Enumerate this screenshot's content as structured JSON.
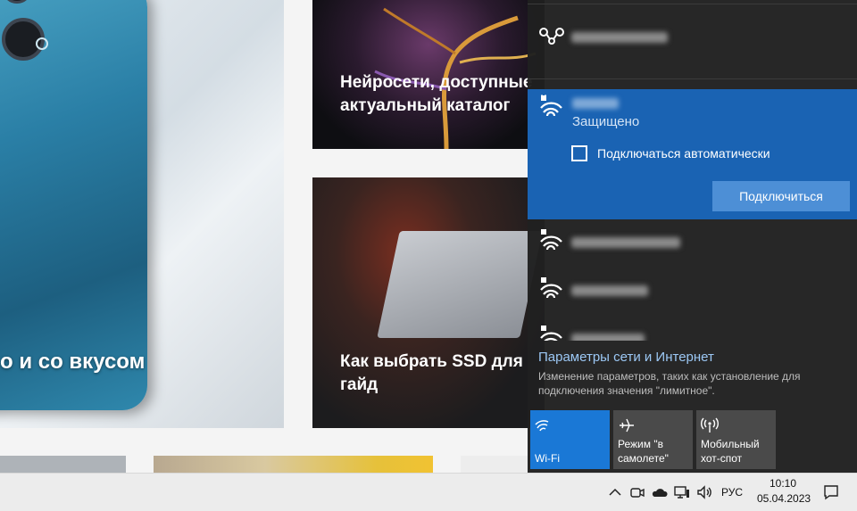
{
  "background": {
    "phone_caption": "о и со вкусом",
    "card_ai_caption": [
      "Нейросети, доступные",
      "актуальный каталог"
    ],
    "card_ssd_caption": [
      "Как выбрать SSD для",
      "гайд"
    ]
  },
  "flyout": {
    "active_network": {
      "status": "Защищено",
      "auto_connect_label": "Подключаться автоматически",
      "auto_connect_checked": false,
      "connect_button": "Подключиться"
    },
    "settings_link": "Параметры сети и Интернет",
    "settings_description": "Изменение параметров, таких как установление для подключения значения \"лимитное\".",
    "tiles": {
      "wifi": "Wi-Fi",
      "airplane": "Режим \"в самолете\"",
      "hotspot": "Мобильный хот-спот"
    },
    "colors": {
      "accent": "#1a63b3",
      "tile_active": "#1a78d6",
      "link": "#9cc8f5"
    }
  },
  "taskbar": {
    "language": "РУС",
    "time": "10:10",
    "date": "05.04.2023",
    "icons": [
      "chevron-up-icon",
      "meet-now-icon",
      "onedrive-cloud-icon",
      "network-icon",
      "volume-icon",
      "notification-icon"
    ]
  }
}
